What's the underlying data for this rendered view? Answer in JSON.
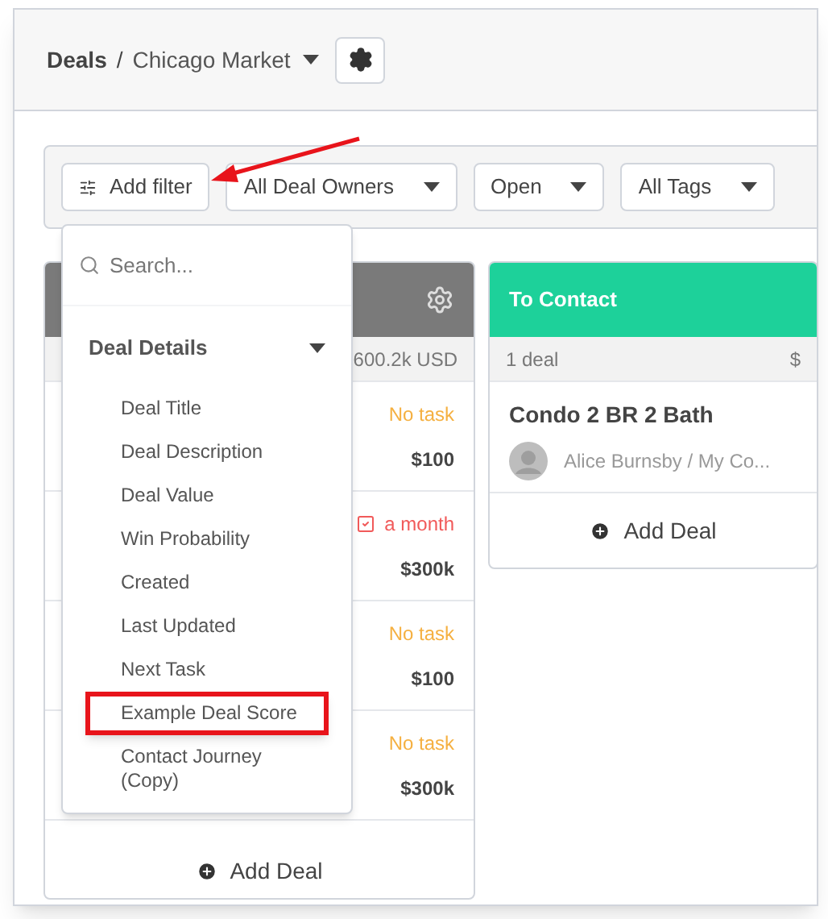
{
  "header": {
    "root": "Deals",
    "separator": "/",
    "pipeline": "Chicago Market"
  },
  "filters": [
    {
      "label": "Add filter",
      "kind": "add"
    },
    {
      "label": "All Deal Owners",
      "kind": "dropdown"
    },
    {
      "label": "Open",
      "kind": "dropdown"
    },
    {
      "label": "All Tags",
      "kind": "dropdown"
    }
  ],
  "columns": [
    {
      "color": "#7a7a7a",
      "summary_value": "600.2k USD",
      "deals": [
        {
          "task": "No task",
          "overdue": false,
          "value": "$100"
        },
        {
          "task": "a month",
          "overdue": true,
          "value": "$300k"
        },
        {
          "task": "No task",
          "overdue": false,
          "value": "$100"
        },
        {
          "task": "No task",
          "overdue": false,
          "value": "$300k"
        }
      ],
      "add_label": "Add Deal"
    },
    {
      "color": "#1dd19a",
      "title": "To Contact",
      "summary_count": "1 deal",
      "summary_value": "$",
      "deals": [
        {
          "title": "Condo 2 BR 2 Bath",
          "contact": "Alice Burnsby / My Co..."
        }
      ],
      "add_label": "Add Deal"
    }
  ],
  "filter_menu": {
    "placeholder": "Search...",
    "section": {
      "label": "Deal Details",
      "expanded": true,
      "items": [
        {
          "label": "Deal Title",
          "highlighted": false
        },
        {
          "label": "Deal Description",
          "highlighted": false
        },
        {
          "label": "Deal Value",
          "highlighted": false
        },
        {
          "label": "Win Probability",
          "highlighted": false
        },
        {
          "label": "Created",
          "highlighted": false
        },
        {
          "label": "Last Updated",
          "highlighted": false
        },
        {
          "label": "Next Task",
          "highlighted": false
        },
        {
          "label": "Example Deal Score",
          "highlighted": true
        },
        {
          "label": "Contact Journey (Copy)",
          "highlighted": false
        }
      ]
    }
  }
}
